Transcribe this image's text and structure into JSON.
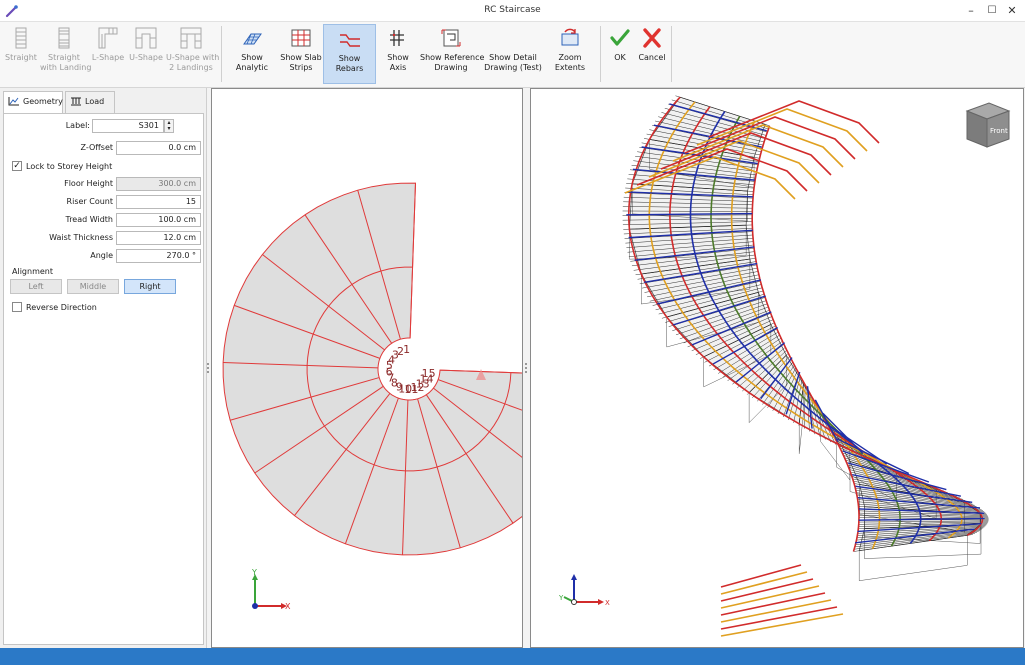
{
  "window": {
    "title": "RC Staircase",
    "minimize": "–",
    "maximize": "☐",
    "close": "✕"
  },
  "ribbon": {
    "buttons": [
      {
        "label": "Straight",
        "icon": "straight-stair-icon",
        "enabled": false
      },
      {
        "label": "Straight\nwith Landing",
        "icon": "straight-landing-stair-icon",
        "enabled": false
      },
      {
        "label": "L-Shape",
        "icon": "l-shape-stair-icon",
        "enabled": false
      },
      {
        "label": "U-Shape",
        "icon": "u-shape-stair-icon",
        "enabled": false
      },
      {
        "label": "U-Shape with\n2 Landings",
        "icon": "u-shape-2-landings-icon",
        "enabled": false
      },
      {
        "label": "Show Analytic",
        "icon": "analytic-icon",
        "enabled": true
      },
      {
        "label": "Show Slab\nStrips",
        "icon": "slab-strips-icon",
        "enabled": true
      },
      {
        "label": "Show Rebars",
        "icon": "rebars-icon",
        "enabled": true,
        "active": true
      },
      {
        "label": "Show Axis",
        "icon": "axis-icon",
        "enabled": true
      },
      {
        "label": "Show Reference\nDrawing",
        "icon": "reference-drawing-icon",
        "enabled": true
      },
      {
        "label": "Show Detail\nDrawing (Test)",
        "icon": "detail-drawing-icon",
        "enabled": true
      },
      {
        "label": "Zoom Extents",
        "icon": "zoom-extents-icon",
        "enabled": true
      },
      {
        "label": "OK",
        "icon": "checkmark-icon",
        "enabled": true
      },
      {
        "label": "Cancel",
        "icon": "cancel-x-icon",
        "enabled": true
      }
    ]
  },
  "tabs": [
    {
      "label": "Geometry",
      "icon": "geometry-icon",
      "active": true
    },
    {
      "label": "Load",
      "icon": "load-icon",
      "active": false
    }
  ],
  "geometry": {
    "label_caption": "Label:",
    "label_value": "S301",
    "z_offset_caption": "Z-Offset",
    "z_offset_value": "0.0 cm",
    "lock_caption": "Lock to Storey Height",
    "lock_checked": "✓",
    "floor_height_caption": "Floor Height",
    "floor_height_value": "300.0 cm",
    "riser_count_caption": "Riser Count",
    "riser_count_value": "15",
    "tread_width_caption": "Tread Width",
    "tread_width_value": "100.0 cm",
    "waist_thickness_caption": "Waist Thickness",
    "waist_thickness_value": "12.0 cm",
    "angle_caption": "Angle",
    "angle_value": "270.0 °",
    "alignment_caption": "Alignment",
    "align_left": "Left",
    "align_middle": "Middle",
    "align_right": "Right",
    "reverse_caption": "Reverse Direction"
  },
  "plan_view": {
    "step_numbers": [
      "1",
      "2",
      "3",
      "4",
      "5",
      "6",
      "7",
      "8",
      "9",
      "10",
      "11",
      "12",
      "13",
      "14",
      "15"
    ],
    "axis_x": "X",
    "axis_y": "Y"
  },
  "view_3d": {
    "viewcube_label": "Front",
    "axis_x": "X",
    "axis_y": "Y",
    "axis_z": "Z"
  },
  "colors": {
    "accent": "#2b79c7",
    "plan_lines": "#e03a3a",
    "plan_fill": "#dedede",
    "rebar_red": "#d12b2b",
    "rebar_blue": "#1f2fa8",
    "rebar_orange": "#e0a020",
    "rebar_green": "#4c7a2a"
  }
}
